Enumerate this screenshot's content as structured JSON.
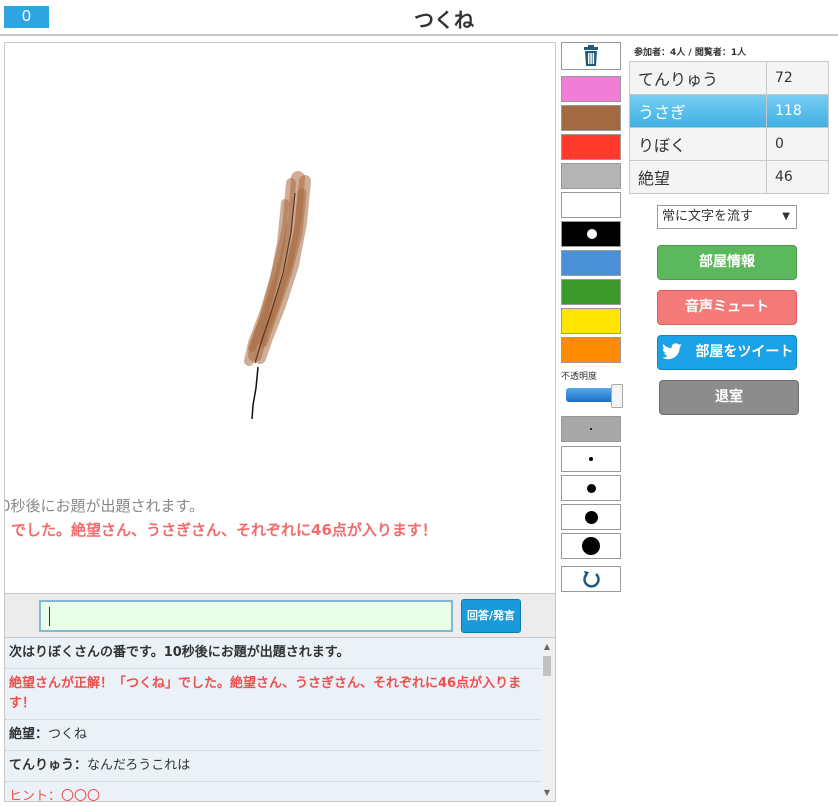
{
  "header": {
    "timer": "0",
    "title": "つくね"
  },
  "canvas": {
    "flow_text_1": "0秒後にお題が出題されます。",
    "flow_text_2": "でした。絶望さん、うさぎさん、それぞれに46点が入ります！"
  },
  "input": {
    "value": "",
    "button_label": "回答/発言"
  },
  "chat": [
    {
      "text": "次はりぼくさんの番です。10秒後にお題が出題されます。",
      "style": "bold"
    },
    {
      "text": "絶望さんが正解！「つくね」でした。絶望さん、うさぎさん、それぞれに46点が入ります！",
      "style": "red-bold"
    },
    {
      "name": "絶望",
      "sep": "：",
      "text": "つくね",
      "style": "normal"
    },
    {
      "name": "てんりゅう",
      "sep": "：",
      "text": "なんだろうこれは",
      "style": "normal"
    },
    {
      "text": "ヒント：〇〇〇",
      "style": "red"
    }
  ],
  "toolbar": {
    "colors": [
      "#f07ed6",
      "#a36a42",
      "#ff3a2a",
      "#b4b4b4",
      "#ffffff",
      "#000000",
      "#4a90d9",
      "#3c9a2c",
      "#ffe500",
      "#ff8c00"
    ],
    "opacity_label": "不透明度",
    "opacity_value": 1.0,
    "trash_icon": "trash-icon",
    "undo_icon": "undo-icon"
  },
  "room": {
    "counts": "参加者：4人 / 閲覧者：1人",
    "players": [
      {
        "name": "てんりゅう",
        "score": "72",
        "active": false
      },
      {
        "name": "うさぎ",
        "score": "118",
        "active": true
      },
      {
        "name": "りぼく",
        "score": "0",
        "active": false
      },
      {
        "name": "絶望",
        "score": "46",
        "active": false
      }
    ],
    "flow_select": "常に文字を流す",
    "buttons": {
      "info": "部屋情報",
      "mute": "音声ミュート",
      "tweet": "部屋をツイート",
      "exit": "退室"
    }
  }
}
